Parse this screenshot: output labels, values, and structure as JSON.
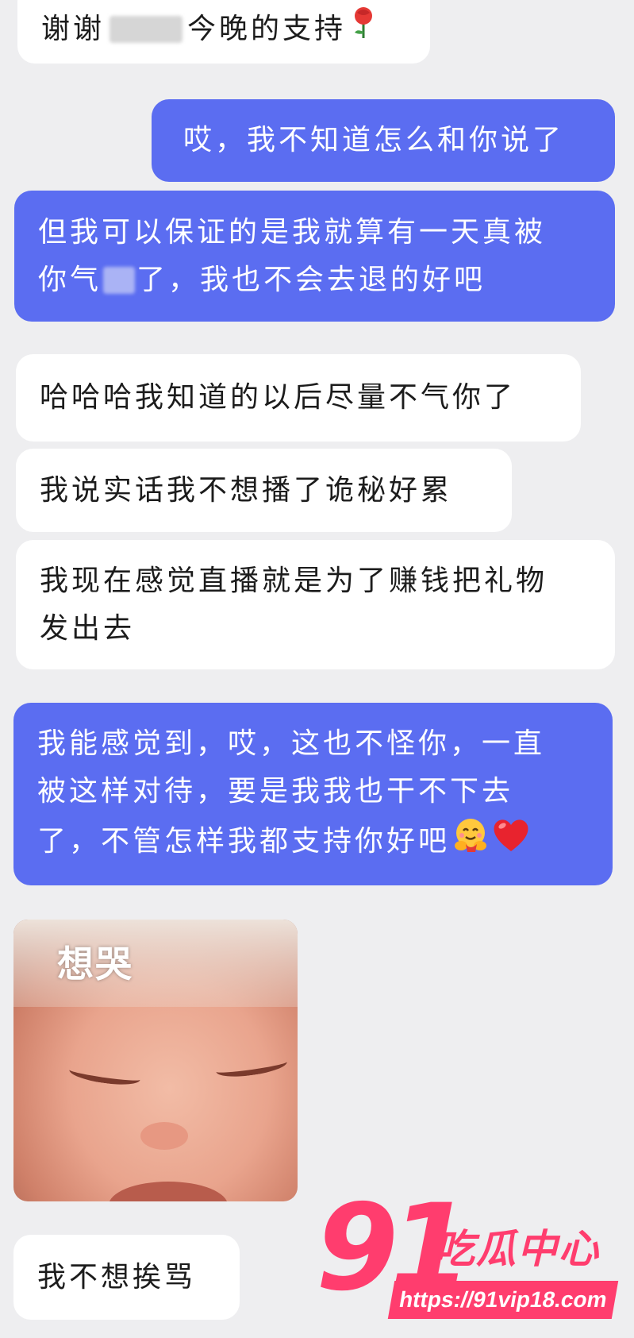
{
  "messages": [
    {
      "id": "m1",
      "side": "in",
      "text_a": "谢谢",
      "text_b": "今晚的支持"
    },
    {
      "id": "m2",
      "side": "out",
      "text": "哎，我不知道怎么和你说了"
    },
    {
      "id": "m3",
      "side": "out",
      "line1": "但我可以保证的是我就算有一天真被",
      "line2_a": "你气",
      "line2_b": "了，我也不会去退的好吧"
    },
    {
      "id": "m4",
      "side": "in",
      "text": "哈哈哈我知道的以后尽量不气你了"
    },
    {
      "id": "m5",
      "side": "in",
      "text": "我说实话我不想播了诡秘好累"
    },
    {
      "id": "m6",
      "side": "in",
      "line1": "我现在感觉直播就是为了赚钱把礼物",
      "line2": "发出去"
    },
    {
      "id": "m7",
      "side": "out",
      "line1": "我能感觉到，哎，这也不怪你，一直",
      "line2": "被这样对待，要是我我也干不下去",
      "line3": "了，不管怎样我都支持你好吧"
    },
    {
      "id": "m9",
      "side": "in",
      "text": "我不想挨骂"
    }
  ],
  "sticker": {
    "caption": "想哭"
  },
  "emojis": {
    "rose": "rose-emoji",
    "hug": "hugging-face-emoji",
    "heart": "red-heart-emoji"
  },
  "watermark": {
    "number": "91",
    "title": "吃瓜中心",
    "url": "https://91vip18.com"
  },
  "colors": {
    "background": "#eeeef0",
    "incoming": "#ffffff",
    "outgoing": "#5b6df1",
    "watermark": "#ff3d6e"
  }
}
